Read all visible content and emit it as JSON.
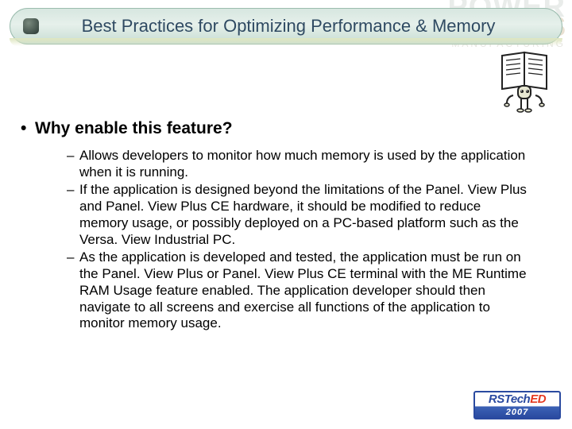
{
  "watermark": {
    "line1": "POWER",
    "line2": "BUSINESS",
    "line3": "MANUFACTURING"
  },
  "title": "Best Practices for Optimizing Performance & Memory",
  "lead": "Why enable this feature?",
  "bullets": [
    "Allows developers to monitor how much memory is used by the application when it is running.",
    "If the application is designed beyond the limitations of the Panel. View Plus and Panel. View Plus CE hardware, it should be modified to reduce memory usage, or possibly deployed on a PC-based platform such as the Versa. View Industrial PC.",
    "As the application is developed and tested, the application must be run on the Panel. View Plus or Panel. View Plus CE terminal with the ME Runtime RAM Usage feature enabled. The application developer should then navigate to all screens and exercise all functions of the application to monitor memory usage."
  ],
  "footer": {
    "brand_left": "RSTech",
    "brand_right": "ED",
    "year": "2007"
  }
}
